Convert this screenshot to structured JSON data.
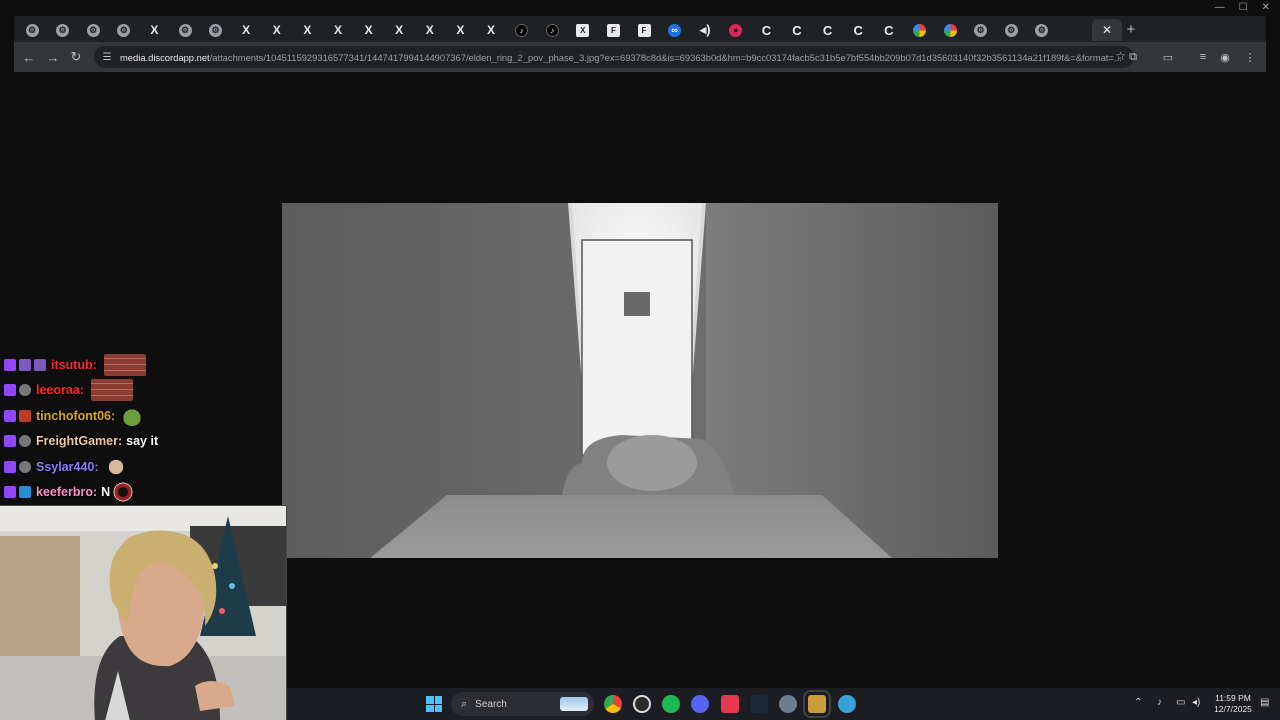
{
  "browser": {
    "tabs": [
      {
        "icon": "generic-icon",
        "glyph": "⚙"
      },
      {
        "icon": "generic-icon",
        "glyph": "⚙"
      },
      {
        "icon": "generic-icon",
        "glyph": "⚙"
      },
      {
        "icon": "generic-icon",
        "glyph": "⚙"
      },
      {
        "icon": "x-icon",
        "glyph": "X"
      },
      {
        "icon": "generic-icon",
        "glyph": "⚙"
      },
      {
        "icon": "generic-icon",
        "glyph": "⚙"
      },
      {
        "icon": "x-icon",
        "glyph": "X"
      },
      {
        "icon": "x-icon",
        "glyph": "X"
      },
      {
        "icon": "x-icon",
        "glyph": "X"
      },
      {
        "icon": "x-icon",
        "glyph": "X"
      },
      {
        "icon": "x-icon",
        "glyph": "X"
      },
      {
        "icon": "x-icon",
        "glyph": "X"
      },
      {
        "icon": "x-icon",
        "glyph": "X"
      },
      {
        "icon": "x-icon",
        "glyph": "X"
      },
      {
        "icon": "x-icon",
        "glyph": "X"
      },
      {
        "icon": "tiktok-icon",
        "glyph": "♪"
      },
      {
        "icon": "tiktok-icon",
        "glyph": "♪"
      },
      {
        "icon": "square-icon",
        "glyph": "X"
      },
      {
        "icon": "square-icon",
        "glyph": "F"
      },
      {
        "icon": "square-icon",
        "glyph": "F"
      },
      {
        "icon": "blue-circle-icon",
        "glyph": "∞"
      },
      {
        "icon": "sound-icon",
        "glyph": "◂)"
      },
      {
        "icon": "red-circle-icon",
        "glyph": "●"
      },
      {
        "icon": "c-icon",
        "glyph": "C"
      },
      {
        "icon": "c-icon",
        "glyph": "C"
      },
      {
        "icon": "c-icon",
        "glyph": "C"
      },
      {
        "icon": "c-icon",
        "glyph": "C"
      },
      {
        "icon": "c-icon",
        "glyph": "C"
      },
      {
        "icon": "google-icon",
        "glyph": ""
      },
      {
        "icon": "google-icon",
        "glyph": ""
      },
      {
        "icon": "generic-icon",
        "glyph": "⚙"
      },
      {
        "icon": "generic-icon",
        "glyph": "⚙"
      },
      {
        "icon": "generic-icon",
        "glyph": "⚙"
      }
    ],
    "active_tab_close": "✕",
    "new_tab": "+",
    "window_controls": {
      "minimize": "—",
      "maximize": "☐",
      "close": "✕"
    },
    "nav": {
      "back": "←",
      "forward": "→",
      "reload": "↻"
    },
    "url_host": "media.discordapp.net",
    "url_path": "/attachments/1045115929316577341/1447417994144907367/elden_ring_2_pov_phase_3.jpg?ex=69378c8d&is=69363b0d&hm=b9cc03174facb5c31b5e7bf554bb209b07d1d35603140f32b3561134a21f189f&=&format=..."
  },
  "chat": [
    {
      "user": "itsutub:",
      "color": "#ff2a2a",
      "message": "",
      "emote": "brick"
    },
    {
      "user": "leeoraa:",
      "color": "#ff2a2a",
      "message": "",
      "emote": "brick"
    },
    {
      "user": "tinchofont06:",
      "color": "#daa520",
      "message": "",
      "emote": "frog"
    },
    {
      "user": "FreightGamer:",
      "color": "#f0c8a0",
      "message": "say it",
      "emote": ""
    },
    {
      "user": "Ssylar440:",
      "color": "#8a7cff",
      "message": "",
      "emote": "head"
    },
    {
      "user": "keeferbro:",
      "color": "#ff8fc8",
      "message": "N",
      "emote": "ring"
    }
  ],
  "taskbar": {
    "search_label": "Search",
    "apps": [
      "chrome-icon",
      "obs-icon",
      "spotify-icon",
      "discord-icon",
      "ytmusic-icon",
      "steam-icon",
      "settings-icon",
      "league-icon",
      "world-icon"
    ],
    "time": "11:59 PM",
    "date": "12/7/2025"
  }
}
